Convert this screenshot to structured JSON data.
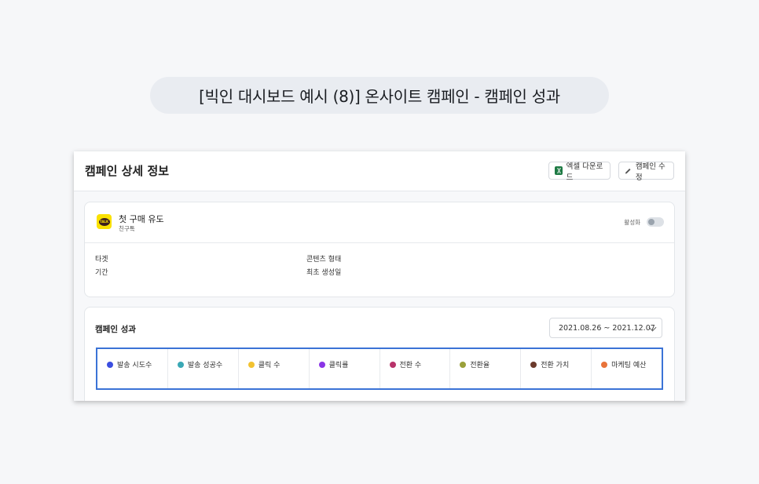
{
  "page_title": "[빅인 대시보드 예시 (8)] 온사이트 캠페인 - 캠페인 성과",
  "panel": {
    "title": "캠페인 상세 정보",
    "excel_button": "엑셀 다운로드",
    "edit_button": "캠페인 수정"
  },
  "campaign": {
    "name": "첫 구매 유도",
    "channel": "친구톡",
    "talk_icon_text": "TALK",
    "toggle_label": "활성화",
    "toggle_on": false
  },
  "fields": {
    "target": "타겟",
    "period": "기간",
    "content_type": "콘텐츠 형태",
    "first_created": "최초 생성일"
  },
  "performance": {
    "title": "캠페인 성과",
    "date_range": "2021.08.26 ~ 2021.12.07",
    "metrics": [
      {
        "label": "발송 시도수",
        "color": "#3b4ee0"
      },
      {
        "label": "발송 성공수",
        "color": "#3aa8b5"
      },
      {
        "label": "클릭 수",
        "color": "#f2c230"
      },
      {
        "label": "클릭률",
        "color": "#8a35e6"
      },
      {
        "label": "전환 수",
        "color": "#b8336a"
      },
      {
        "label": "전환율",
        "color": "#9aa03a"
      },
      {
        "label": "전환 가치",
        "color": "#6b3a2c"
      },
      {
        "label": "마케팅 예산",
        "color": "#e8733a"
      }
    ]
  }
}
